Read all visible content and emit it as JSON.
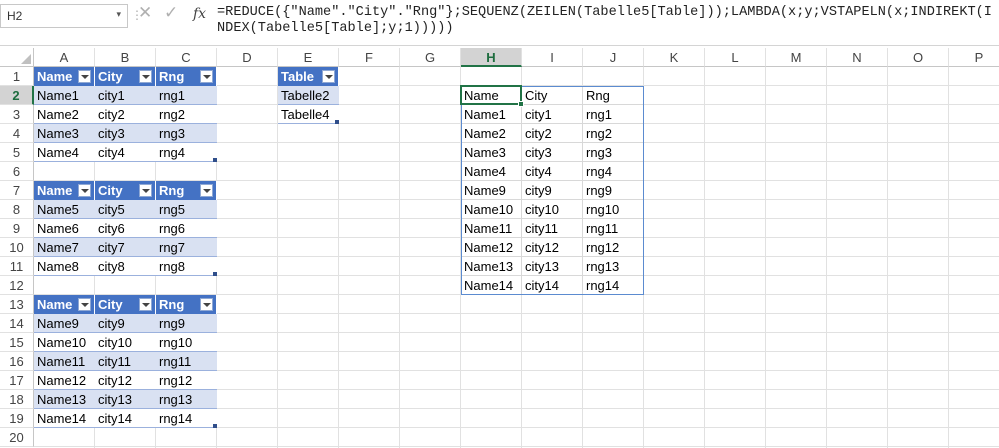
{
  "formula_bar": {
    "name_box": "H2",
    "name_box_arrow": "▾",
    "separator": "⋮",
    "cancel_symbol": "✕",
    "enter_symbol": "✓",
    "fx_label": "fx",
    "formula": "=REDUCE({\"Name\".\"City\".\"Rng\"};SEQUENZ(ZEILEN(Tabelle5[Table]));LAMBDA(x;y;VSTAPELN(x;INDIREKT(INDEX(Tabelle5[Table];y;1)))))"
  },
  "columns": [
    "A",
    "B",
    "C",
    "D",
    "E",
    "F",
    "G",
    "H",
    "I",
    "J",
    "K",
    "L",
    "M",
    "N",
    "O",
    "P"
  ],
  "selected_column": "H",
  "rows": [
    "1",
    "2",
    "3",
    "4",
    "5",
    "6",
    "7",
    "8",
    "9",
    "10",
    "11",
    "12",
    "13",
    "14",
    "15",
    "16",
    "17",
    "18",
    "19",
    "20"
  ],
  "selected_row": "2",
  "tables": [
    {
      "headers": [
        "Name",
        "City",
        "Rng"
      ],
      "rows": [
        [
          "Name1",
          "city1",
          "rng1"
        ],
        [
          "Name2",
          "city2",
          "rng2"
        ],
        [
          "Name3",
          "city3",
          "rng3"
        ],
        [
          "Name4",
          "city4",
          "rng4"
        ]
      ]
    },
    {
      "headers": [
        "Name",
        "City",
        "Rng"
      ],
      "rows": [
        [
          "Name5",
          "city5",
          "rng5"
        ],
        [
          "Name6",
          "city6",
          "rng6"
        ],
        [
          "Name7",
          "city7",
          "rng7"
        ],
        [
          "Name8",
          "city8",
          "rng8"
        ]
      ]
    },
    {
      "headers": [
        "Name",
        "City",
        "Rng"
      ],
      "rows": [
        [
          "Name9",
          "city9",
          "rng9"
        ],
        [
          "Name10",
          "city10",
          "rng10"
        ],
        [
          "Name11",
          "city11",
          "rng11"
        ],
        [
          "Name12",
          "city12",
          "rng12"
        ],
        [
          "Name13",
          "city13",
          "rng13"
        ],
        [
          "Name14",
          "city14",
          "rng14"
        ]
      ]
    }
  ],
  "lookup_table": {
    "headers": [
      "Table"
    ],
    "rows": [
      [
        "Tabelle2"
      ],
      [
        "Tabelle4"
      ]
    ]
  },
  "output": [
    [
      "Name",
      "City",
      "Rng"
    ],
    [
      "Name1",
      "city1",
      "rng1"
    ],
    [
      "Name2",
      "city2",
      "rng2"
    ],
    [
      "Name3",
      "city3",
      "rng3"
    ],
    [
      "Name4",
      "city4",
      "rng4"
    ],
    [
      "Name9",
      "city9",
      "rng9"
    ],
    [
      "Name10",
      "city10",
      "rng10"
    ],
    [
      "Name11",
      "city11",
      "rng11"
    ],
    [
      "Name12",
      "city12",
      "rng12"
    ],
    [
      "Name13",
      "city13",
      "rng13"
    ],
    [
      "Name14",
      "city14",
      "rng14"
    ]
  ],
  "colors": {
    "table_header": "#4472c4",
    "table_band": "#d9e1f2",
    "selection": "#217346"
  }
}
